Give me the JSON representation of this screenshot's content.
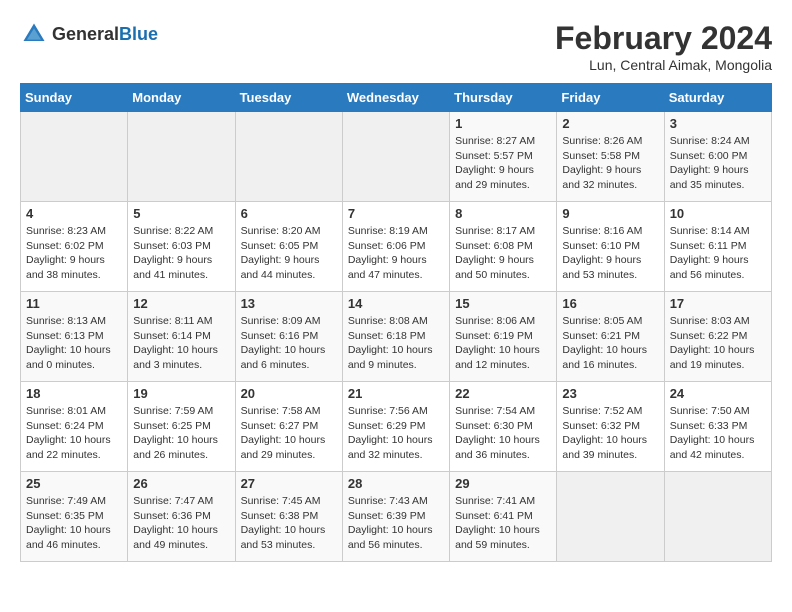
{
  "header": {
    "logo_general": "General",
    "logo_blue": "Blue",
    "month_year": "February 2024",
    "location": "Lun, Central Aimak, Mongolia"
  },
  "days_of_week": [
    "Sunday",
    "Monday",
    "Tuesday",
    "Wednesday",
    "Thursday",
    "Friday",
    "Saturday"
  ],
  "weeks": [
    [
      {
        "day": "",
        "info": ""
      },
      {
        "day": "",
        "info": ""
      },
      {
        "day": "",
        "info": ""
      },
      {
        "day": "",
        "info": ""
      },
      {
        "day": "1",
        "info": "Sunrise: 8:27 AM\nSunset: 5:57 PM\nDaylight: 9 hours\nand 29 minutes."
      },
      {
        "day": "2",
        "info": "Sunrise: 8:26 AM\nSunset: 5:58 PM\nDaylight: 9 hours\nand 32 minutes."
      },
      {
        "day": "3",
        "info": "Sunrise: 8:24 AM\nSunset: 6:00 PM\nDaylight: 9 hours\nand 35 minutes."
      }
    ],
    [
      {
        "day": "4",
        "info": "Sunrise: 8:23 AM\nSunset: 6:02 PM\nDaylight: 9 hours\nand 38 minutes."
      },
      {
        "day": "5",
        "info": "Sunrise: 8:22 AM\nSunset: 6:03 PM\nDaylight: 9 hours\nand 41 minutes."
      },
      {
        "day": "6",
        "info": "Sunrise: 8:20 AM\nSunset: 6:05 PM\nDaylight: 9 hours\nand 44 minutes."
      },
      {
        "day": "7",
        "info": "Sunrise: 8:19 AM\nSunset: 6:06 PM\nDaylight: 9 hours\nand 47 minutes."
      },
      {
        "day": "8",
        "info": "Sunrise: 8:17 AM\nSunset: 6:08 PM\nDaylight: 9 hours\nand 50 minutes."
      },
      {
        "day": "9",
        "info": "Sunrise: 8:16 AM\nSunset: 6:10 PM\nDaylight: 9 hours\nand 53 minutes."
      },
      {
        "day": "10",
        "info": "Sunrise: 8:14 AM\nSunset: 6:11 PM\nDaylight: 9 hours\nand 56 minutes."
      }
    ],
    [
      {
        "day": "11",
        "info": "Sunrise: 8:13 AM\nSunset: 6:13 PM\nDaylight: 10 hours\nand 0 minutes."
      },
      {
        "day": "12",
        "info": "Sunrise: 8:11 AM\nSunset: 6:14 PM\nDaylight: 10 hours\nand 3 minutes."
      },
      {
        "day": "13",
        "info": "Sunrise: 8:09 AM\nSunset: 6:16 PM\nDaylight: 10 hours\nand 6 minutes."
      },
      {
        "day": "14",
        "info": "Sunrise: 8:08 AM\nSunset: 6:18 PM\nDaylight: 10 hours\nand 9 minutes."
      },
      {
        "day": "15",
        "info": "Sunrise: 8:06 AM\nSunset: 6:19 PM\nDaylight: 10 hours\nand 12 minutes."
      },
      {
        "day": "16",
        "info": "Sunrise: 8:05 AM\nSunset: 6:21 PM\nDaylight: 10 hours\nand 16 minutes."
      },
      {
        "day": "17",
        "info": "Sunrise: 8:03 AM\nSunset: 6:22 PM\nDaylight: 10 hours\nand 19 minutes."
      }
    ],
    [
      {
        "day": "18",
        "info": "Sunrise: 8:01 AM\nSunset: 6:24 PM\nDaylight: 10 hours\nand 22 minutes."
      },
      {
        "day": "19",
        "info": "Sunrise: 7:59 AM\nSunset: 6:25 PM\nDaylight: 10 hours\nand 26 minutes."
      },
      {
        "day": "20",
        "info": "Sunrise: 7:58 AM\nSunset: 6:27 PM\nDaylight: 10 hours\nand 29 minutes."
      },
      {
        "day": "21",
        "info": "Sunrise: 7:56 AM\nSunset: 6:29 PM\nDaylight: 10 hours\nand 32 minutes."
      },
      {
        "day": "22",
        "info": "Sunrise: 7:54 AM\nSunset: 6:30 PM\nDaylight: 10 hours\nand 36 minutes."
      },
      {
        "day": "23",
        "info": "Sunrise: 7:52 AM\nSunset: 6:32 PM\nDaylight: 10 hours\nand 39 minutes."
      },
      {
        "day": "24",
        "info": "Sunrise: 7:50 AM\nSunset: 6:33 PM\nDaylight: 10 hours\nand 42 minutes."
      }
    ],
    [
      {
        "day": "25",
        "info": "Sunrise: 7:49 AM\nSunset: 6:35 PM\nDaylight: 10 hours\nand 46 minutes."
      },
      {
        "day": "26",
        "info": "Sunrise: 7:47 AM\nSunset: 6:36 PM\nDaylight: 10 hours\nand 49 minutes."
      },
      {
        "day": "27",
        "info": "Sunrise: 7:45 AM\nSunset: 6:38 PM\nDaylight: 10 hours\nand 53 minutes."
      },
      {
        "day": "28",
        "info": "Sunrise: 7:43 AM\nSunset: 6:39 PM\nDaylight: 10 hours\nand 56 minutes."
      },
      {
        "day": "29",
        "info": "Sunrise: 7:41 AM\nSunset: 6:41 PM\nDaylight: 10 hours\nand 59 minutes."
      },
      {
        "day": "",
        "info": ""
      },
      {
        "day": "",
        "info": ""
      }
    ]
  ]
}
